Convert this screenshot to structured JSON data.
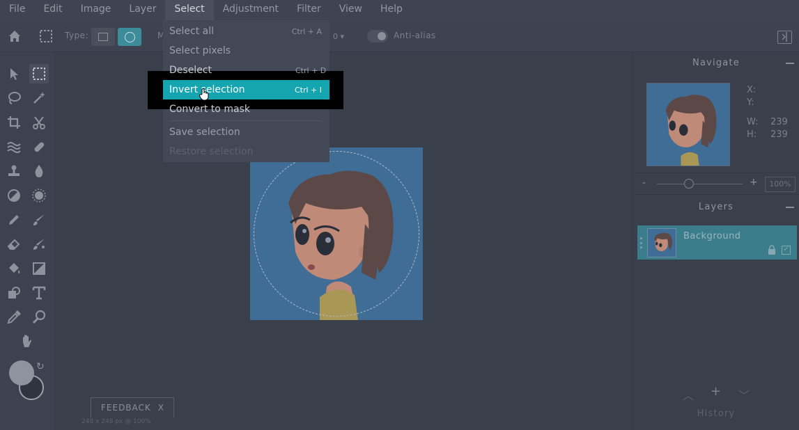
{
  "menubar": {
    "items": [
      "File",
      "Edit",
      "Image",
      "Layer",
      "Select",
      "Adjustment",
      "Filter",
      "View",
      "Help"
    ],
    "active": "Select"
  },
  "options": {
    "home_icon": "home-icon",
    "marquee_icon": "rect-marquee-icon",
    "type_label": "Type:",
    "type_rect_icon": "rectangle-icon",
    "type_ellipse_icon": "ellipse-icon",
    "m_label": "M",
    "number_value": "0",
    "antialias_label": "Anti-alias",
    "collapse_icon": "panel-toggle-icon"
  },
  "select_menu": {
    "items": [
      {
        "label": "Select all",
        "shortcut": "Ctrl + A"
      },
      {
        "label": "Select pixels",
        "shortcut": ""
      },
      {
        "label": "Deselect",
        "shortcut": "Ctrl + D"
      },
      {
        "label": "Invert selection",
        "shortcut": "Ctrl + I"
      },
      {
        "label": "Convert to mask",
        "shortcut": ""
      },
      {
        "label": "Save selection",
        "shortcut": ""
      },
      {
        "label": "Restore selection",
        "shortcut": ""
      }
    ],
    "highlighted": "Invert selection"
  },
  "navigate": {
    "title": "Navigate",
    "x_label": "X:",
    "y_label": "Y:",
    "w_label": "W:",
    "w_value": "239",
    "h_label": "H:",
    "h_value": "239",
    "zoom_minus": "-",
    "zoom_plus": "+",
    "zoom_value": "100%"
  },
  "layers": {
    "title": "Layers",
    "items": [
      {
        "name": "Background"
      }
    ]
  },
  "history": {
    "title": "History"
  },
  "feedback": {
    "label": "FEEDBACK",
    "close": "X"
  },
  "status": {
    "text": "248 x 248 px @ 100%"
  },
  "colors": {
    "accent": "#14a5b1",
    "canvas_bg": "#3f6d96"
  }
}
